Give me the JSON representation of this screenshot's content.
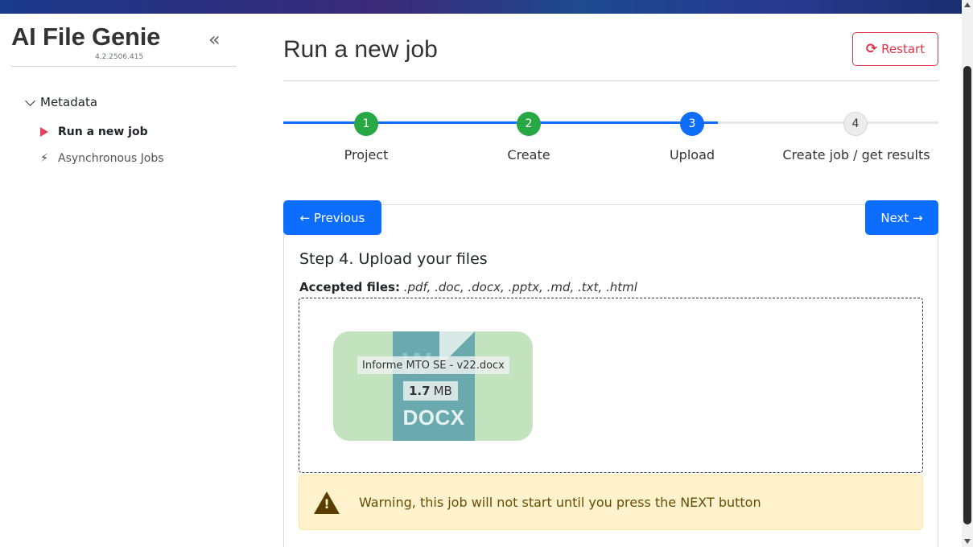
{
  "sidebar": {
    "app_title": "AI File Genie",
    "version": "4.2.2506.415",
    "collapse_glyph": "«",
    "group_label": "Metadata",
    "items": [
      {
        "label": "Run a new job",
        "icon": "play-icon",
        "active": true
      },
      {
        "label": "Asynchronous Jobs",
        "icon": "bolt-icon",
        "active": false
      }
    ]
  },
  "header": {
    "title": "Run a new job",
    "restart_label": "Restart"
  },
  "stepper": {
    "steps": [
      {
        "number": "1",
        "label": "Project",
        "state": "complete"
      },
      {
        "number": "2",
        "label": "Create",
        "state": "complete"
      },
      {
        "number": "3",
        "label": "Upload",
        "state": "current"
      },
      {
        "number": "4",
        "label": "Create job / get results",
        "state": "pending"
      }
    ]
  },
  "nav": {
    "previous_label": "← Previous",
    "next_label": "Next →"
  },
  "upload": {
    "heading": "Step 4. Upload your files",
    "accepted_label": "Accepted files:",
    "accepted_types": ".pdf, .doc, .docx, .pptx, .md, .txt, .html",
    "file": {
      "name": "Informe MTO SE - v22.docx",
      "size_value": "1.7",
      "size_unit": "MB",
      "icon_letter": "W",
      "extension": "DOCX"
    }
  },
  "warning": {
    "text": "Warning, this job will not start until you press the NEXT button"
  },
  "colors": {
    "primary": "#0d6efd",
    "success": "#28a745",
    "danger": "#dc3545",
    "warning_bg": "#fff3cd",
    "file_tile": "#c2e3bd"
  }
}
